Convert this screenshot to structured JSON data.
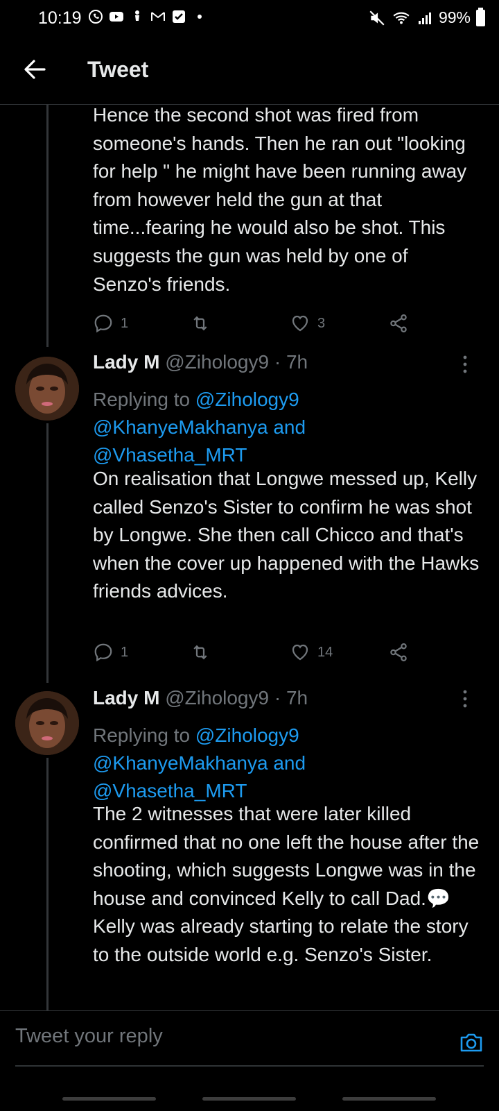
{
  "status_bar": {
    "time": "10:19",
    "battery": "99%",
    "left_icons": [
      "whatsapp-icon",
      "youtube-icon",
      "location-icon",
      "gmail-icon",
      "checkbox-icon",
      "dot-icon"
    ],
    "right_icons": [
      "mute-icon",
      "wifi-icon",
      "signal-icon",
      "battery-icon"
    ]
  },
  "header": {
    "title": "Tweet"
  },
  "tweets": [
    {
      "text": "Hence the second shot was fired from someone's hands. Then he ran out \"looking for help \" he might have been running away from however held the gun at that time...fearing he would also be shot. This suggests the gun was held by one of Senzo's friends.",
      "replies": "1",
      "retweets": "",
      "likes": "3"
    },
    {
      "author": "Lady M",
      "handle": "@Zihology9",
      "time": " · 7h",
      "replying_prefix": "Replying to ",
      "replying_to_1": "@Zihology9",
      "replying_to_2": "@KhanyeMakhanya",
      "replying_and": " and",
      "replying_to_3": "@Vhasetha_MRT",
      "text": "On realisation that Longwe messed up, Kelly called Senzo's Sister to confirm he was shot by Longwe. She then call Chicco and that's when the cover up happened with the Hawks friends advices.",
      "replies": "1",
      "retweets": "",
      "likes": "14"
    },
    {
      "author": "Lady M",
      "handle": "@Zihology9",
      "time": " · 7h",
      "replying_prefix": "Replying to ",
      "replying_to_1": "@Zihology9",
      "replying_to_2": "@KhanyeMakhanya",
      "replying_and": " and",
      "replying_to_3": "@Vhasetha_MRT",
      "text_part1": "The 2 witnesses that were later killed confirmed that no one left the house after the shooting, which suggests Longwe was in the house and convinced Kelly to call Dad.",
      "emoji": "💬",
      "text_part2": " Kelly was already starting to relate the story to the outside world e.g. Senzo's Sister."
    }
  ],
  "composer": {
    "placeholder": "Tweet your reply"
  },
  "colors": {
    "background": "#000000",
    "text": "#e7e9ea",
    "muted": "#71767b",
    "accent": "#1d9bf0"
  }
}
